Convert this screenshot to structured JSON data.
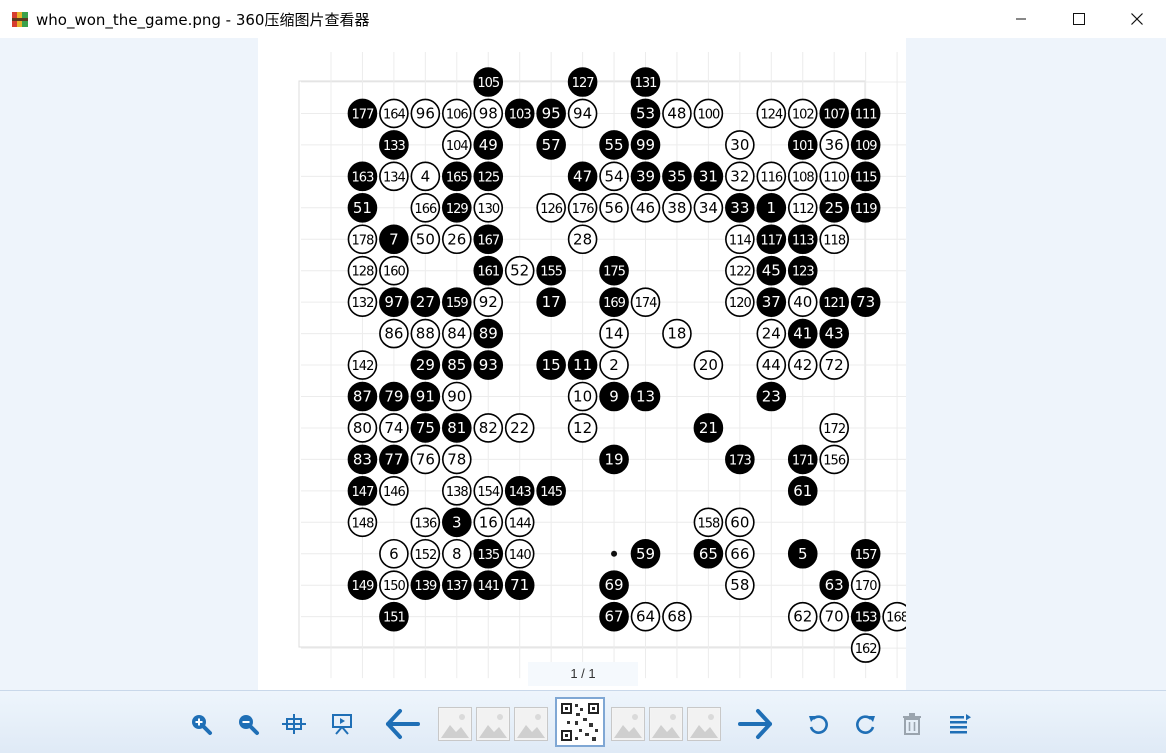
{
  "window": {
    "title": "who_won_the_game.png - 360压缩图片查看器",
    "controls": [
      "minimize",
      "maximize",
      "close"
    ]
  },
  "viewer": {
    "page_indicator": "1 / 1"
  },
  "board": {
    "size": 19,
    "black": [
      {
        "c": 5,
        "r": 0,
        "n": 105
      },
      {
        "c": 8,
        "r": 0,
        "n": 127
      },
      {
        "c": 10,
        "r": 0,
        "n": 131
      },
      {
        "c": 1,
        "r": 1,
        "n": 177
      },
      {
        "c": 6,
        "r": 1,
        "n": 103
      },
      {
        "c": 7,
        "r": 1,
        "n": 95
      },
      {
        "c": 10,
        "r": 1,
        "n": 53
      },
      {
        "c": 16,
        "r": 1,
        "n": 107
      },
      {
        "c": 17,
        "r": 1,
        "n": 111
      },
      {
        "c": 2,
        "r": 2,
        "n": 133
      },
      {
        "c": 5,
        "r": 2,
        "n": 49
      },
      {
        "c": 7,
        "r": 2,
        "n": 57
      },
      {
        "c": 9,
        "r": 2,
        "n": 55
      },
      {
        "c": 10,
        "r": 2,
        "n": 99
      },
      {
        "c": 15,
        "r": 2,
        "n": 101
      },
      {
        "c": 17,
        "r": 2,
        "n": 109
      },
      {
        "c": 1,
        "r": 3,
        "n": 163
      },
      {
        "c": 4,
        "r": 3,
        "n": 165
      },
      {
        "c": 5,
        "r": 3,
        "n": 125
      },
      {
        "c": 8,
        "r": 3,
        "n": 47
      },
      {
        "c": 10,
        "r": 3,
        "n": 39
      },
      {
        "c": 11,
        "r": 3,
        "n": 35
      },
      {
        "c": 12,
        "r": 3,
        "n": 31
      },
      {
        "c": 17,
        "r": 3,
        "n": 115
      },
      {
        "c": 1,
        "r": 4,
        "n": 51
      },
      {
        "c": 4,
        "r": 4,
        "n": 129
      },
      {
        "c": 13,
        "r": 4,
        "n": 33
      },
      {
        "c": 14,
        "r": 4,
        "n": 1
      },
      {
        "c": 16,
        "r": 4,
        "n": 25
      },
      {
        "c": 17,
        "r": 4,
        "n": 119
      },
      {
        "c": 2,
        "r": 5,
        "n": 7
      },
      {
        "c": 5,
        "r": 5,
        "n": 167
      },
      {
        "c": 14,
        "r": 5,
        "n": 117
      },
      {
        "c": 15,
        "r": 5,
        "n": 113
      },
      {
        "c": 5,
        "r": 6,
        "n": 161
      },
      {
        "c": 7,
        "r": 6,
        "n": 155
      },
      {
        "c": 9,
        "r": 6,
        "n": 175
      },
      {
        "c": 14,
        "r": 6,
        "n": 45
      },
      {
        "c": 15,
        "r": 6,
        "n": 123
      },
      {
        "c": 2,
        "r": 7,
        "n": 97
      },
      {
        "c": 3,
        "r": 7,
        "n": 27
      },
      {
        "c": 4,
        "r": 7,
        "n": 159
      },
      {
        "c": 7,
        "r": 7,
        "n": 17
      },
      {
        "c": 9,
        "r": 7,
        "n": 169
      },
      {
        "c": 14,
        "r": 7,
        "n": 37
      },
      {
        "c": 16,
        "r": 7,
        "n": 121
      },
      {
        "c": 17,
        "r": 7,
        "n": 73
      },
      {
        "c": 5,
        "r": 8,
        "n": 89
      },
      {
        "c": 15,
        "r": 8,
        "n": 41
      },
      {
        "c": 16,
        "r": 8,
        "n": 43
      },
      {
        "c": 3,
        "r": 9,
        "n": 29
      },
      {
        "c": 4,
        "r": 9,
        "n": 85
      },
      {
        "c": 5,
        "r": 9,
        "n": 93
      },
      {
        "c": 7,
        "r": 9,
        "n": 15
      },
      {
        "c": 8,
        "r": 9,
        "n": 11
      },
      {
        "c": 1,
        "r": 10,
        "n": 87
      },
      {
        "c": 2,
        "r": 10,
        "n": 79
      },
      {
        "c": 3,
        "r": 10,
        "n": 91
      },
      {
        "c": 9,
        "r": 10,
        "n": 9
      },
      {
        "c": 10,
        "r": 10,
        "n": 13
      },
      {
        "c": 14,
        "r": 10,
        "n": 23
      },
      {
        "c": 3,
        "r": 11,
        "n": 75
      },
      {
        "c": 4,
        "r": 11,
        "n": 81
      },
      {
        "c": 12,
        "r": 11,
        "n": 21
      },
      {
        "c": 1,
        "r": 12,
        "n": 83
      },
      {
        "c": 2,
        "r": 12,
        "n": 77
      },
      {
        "c": 9,
        "r": 12,
        "n": 19
      },
      {
        "c": 13,
        "r": 12,
        "n": 173
      },
      {
        "c": 15,
        "r": 12,
        "n": 171
      },
      {
        "c": 1,
        "r": 13,
        "n": 147
      },
      {
        "c": 6,
        "r": 13,
        "n": 143
      },
      {
        "c": 7,
        "r": 13,
        "n": 145
      },
      {
        "c": 15,
        "r": 13,
        "n": 61
      },
      {
        "c": 4,
        "r": 14,
        "n": 3
      },
      {
        "c": 5,
        "r": 15,
        "n": 135
      },
      {
        "c": 10,
        "r": 15,
        "n": 59
      },
      {
        "c": 12,
        "r": 15,
        "n": 65
      },
      {
        "c": 15,
        "r": 15,
        "n": 5
      },
      {
        "c": 17,
        "r": 15,
        "n": 157
      },
      {
        "c": 1,
        "r": 16,
        "n": 149
      },
      {
        "c": 3,
        "r": 16,
        "n": 139
      },
      {
        "c": 4,
        "r": 16,
        "n": 137
      },
      {
        "c": 5,
        "r": 16,
        "n": 141
      },
      {
        "c": 6,
        "r": 16,
        "n": 71
      },
      {
        "c": 9,
        "r": 16,
        "n": 69
      },
      {
        "c": 16,
        "r": 16,
        "n": 63
      },
      {
        "c": 2,
        "r": 17,
        "n": 151
      },
      {
        "c": 9,
        "r": 17,
        "n": 67
      },
      {
        "c": 17,
        "r": 17,
        "n": 153
      }
    ],
    "white": [
      {
        "c": 2,
        "r": 1,
        "n": 164
      },
      {
        "c": 3,
        "r": 1,
        "n": 96
      },
      {
        "c": 4,
        "r": 1,
        "n": 106
      },
      {
        "c": 5,
        "r": 1,
        "n": 98
      },
      {
        "c": 8,
        "r": 1,
        "n": 94
      },
      {
        "c": 11,
        "r": 1,
        "n": 48
      },
      {
        "c": 12,
        "r": 1,
        "n": 100
      },
      {
        "c": 14,
        "r": 1,
        "n": 124
      },
      {
        "c": 15,
        "r": 1,
        "n": 102
      },
      {
        "c": 4,
        "r": 2,
        "n": 104
      },
      {
        "c": 13,
        "r": 2,
        "n": 30
      },
      {
        "c": 16,
        "r": 2,
        "n": 36
      },
      {
        "c": 2,
        "r": 3,
        "n": 134
      },
      {
        "c": 3,
        "r": 3,
        "n": 4
      },
      {
        "c": 9,
        "r": 3,
        "n": 54
      },
      {
        "c": 13,
        "r": 3,
        "n": 32
      },
      {
        "c": 14,
        "r": 3,
        "n": 116
      },
      {
        "c": 15,
        "r": 3,
        "n": 108
      },
      {
        "c": 16,
        "r": 3,
        "n": 110
      },
      {
        "c": 3,
        "r": 4,
        "n": 166
      },
      {
        "c": 5,
        "r": 4,
        "n": 130
      },
      {
        "c": 7,
        "r": 4,
        "n": 126
      },
      {
        "c": 8,
        "r": 4,
        "n": 176
      },
      {
        "c": 9,
        "r": 4,
        "n": 56
      },
      {
        "c": 10,
        "r": 4,
        "n": 46
      },
      {
        "c": 11,
        "r": 4,
        "n": 38
      },
      {
        "c": 12,
        "r": 4,
        "n": 34
      },
      {
        "c": 15,
        "r": 4,
        "n": 112
      },
      {
        "c": 1,
        "r": 5,
        "n": 178
      },
      {
        "c": 3,
        "r": 5,
        "n": 50
      },
      {
        "c": 4,
        "r": 5,
        "n": 26
      },
      {
        "c": 8,
        "r": 5,
        "n": 28
      },
      {
        "c": 13,
        "r": 5,
        "n": 114
      },
      {
        "c": 16,
        "r": 5,
        "n": 118
      },
      {
        "c": 1,
        "r": 6,
        "n": 128
      },
      {
        "c": 2,
        "r": 6,
        "n": 160
      },
      {
        "c": 6,
        "r": 6,
        "n": 52
      },
      {
        "c": 13,
        "r": 6,
        "n": 122
      },
      {
        "c": 1,
        "r": 7,
        "n": 132
      },
      {
        "c": 5,
        "r": 7,
        "n": 92
      },
      {
        "c": 10,
        "r": 7,
        "n": 174
      },
      {
        "c": 13,
        "r": 7,
        "n": 120
      },
      {
        "c": 15,
        "r": 7,
        "n": 40
      },
      {
        "c": 2,
        "r": 8,
        "n": 86
      },
      {
        "c": 3,
        "r": 8,
        "n": 88
      },
      {
        "c": 4,
        "r": 8,
        "n": 84
      },
      {
        "c": 9,
        "r": 8,
        "n": 14
      },
      {
        "c": 11,
        "r": 8,
        "n": 18
      },
      {
        "c": 14,
        "r": 8,
        "n": 24
      },
      {
        "c": 1,
        "r": 9,
        "n": 142
      },
      {
        "c": 9,
        "r": 9,
        "n": 2
      },
      {
        "c": 12,
        "r": 9,
        "n": 20
      },
      {
        "c": 14,
        "r": 9,
        "n": 44
      },
      {
        "c": 15,
        "r": 9,
        "n": 42
      },
      {
        "c": 16,
        "r": 9,
        "n": 72
      },
      {
        "c": 4,
        "r": 10,
        "n": 90
      },
      {
        "c": 8,
        "r": 10,
        "n": 10
      },
      {
        "c": 1,
        "r": 11,
        "n": 80
      },
      {
        "c": 2,
        "r": 11,
        "n": 74
      },
      {
        "c": 5,
        "r": 11,
        "n": 82
      },
      {
        "c": 6,
        "r": 11,
        "n": 22
      },
      {
        "c": 8,
        "r": 11,
        "n": 12
      },
      {
        "c": 16,
        "r": 11,
        "n": 172
      },
      {
        "c": 3,
        "r": 12,
        "n": 76
      },
      {
        "c": 4,
        "r": 12,
        "n": 78
      },
      {
        "c": 16,
        "r": 12,
        "n": 156
      },
      {
        "c": 2,
        "r": 13,
        "n": 146
      },
      {
        "c": 4,
        "r": 13,
        "n": 138
      },
      {
        "c": 5,
        "r": 13,
        "n": 154
      },
      {
        "c": 1,
        "r": 14,
        "n": 148
      },
      {
        "c": 3,
        "r": 14,
        "n": 136
      },
      {
        "c": 5,
        "r": 14,
        "n": 16
      },
      {
        "c": 6,
        "r": 14,
        "n": 144
      },
      {
        "c": 12,
        "r": 14,
        "n": 158
      },
      {
        "c": 13,
        "r": 14,
        "n": 60
      },
      {
        "c": 2,
        "r": 15,
        "n": 6
      },
      {
        "c": 3,
        "r": 15,
        "n": 152
      },
      {
        "c": 4,
        "r": 15,
        "n": 8
      },
      {
        "c": 6,
        "r": 15,
        "n": 140
      },
      {
        "c": 13,
        "r": 15,
        "n": 66
      },
      {
        "c": 2,
        "r": 16,
        "n": 150
      },
      {
        "c": 13,
        "r": 16,
        "n": 58
      },
      {
        "c": 17,
        "r": 16,
        "n": 170
      },
      {
        "c": 10,
        "r": 17,
        "n": 64
      },
      {
        "c": 11,
        "r": 17,
        "n": 68
      },
      {
        "c": 15,
        "r": 17,
        "n": 62
      },
      {
        "c": 16,
        "r": 17,
        "n": 70
      },
      {
        "c": 18,
        "r": 17,
        "n": 168
      },
      {
        "c": 17,
        "r": 18,
        "n": 162
      }
    ],
    "star_points": [
      {
        "c": 9,
        "r": 15
      }
    ]
  },
  "toolbar": {
    "buttons": [
      "zoom-in-icon",
      "zoom-out-icon",
      "fit-window-icon",
      "slideshow-icon",
      "previous-icon",
      "next-icon",
      "rotate-left-icon",
      "rotate-right-icon",
      "delete-icon",
      "menu-icon"
    ],
    "thumbnail_count": 7,
    "active_thumbnail": 3
  },
  "colors": {
    "accent": "#1f6fb6",
    "background": "#eef4fb"
  }
}
